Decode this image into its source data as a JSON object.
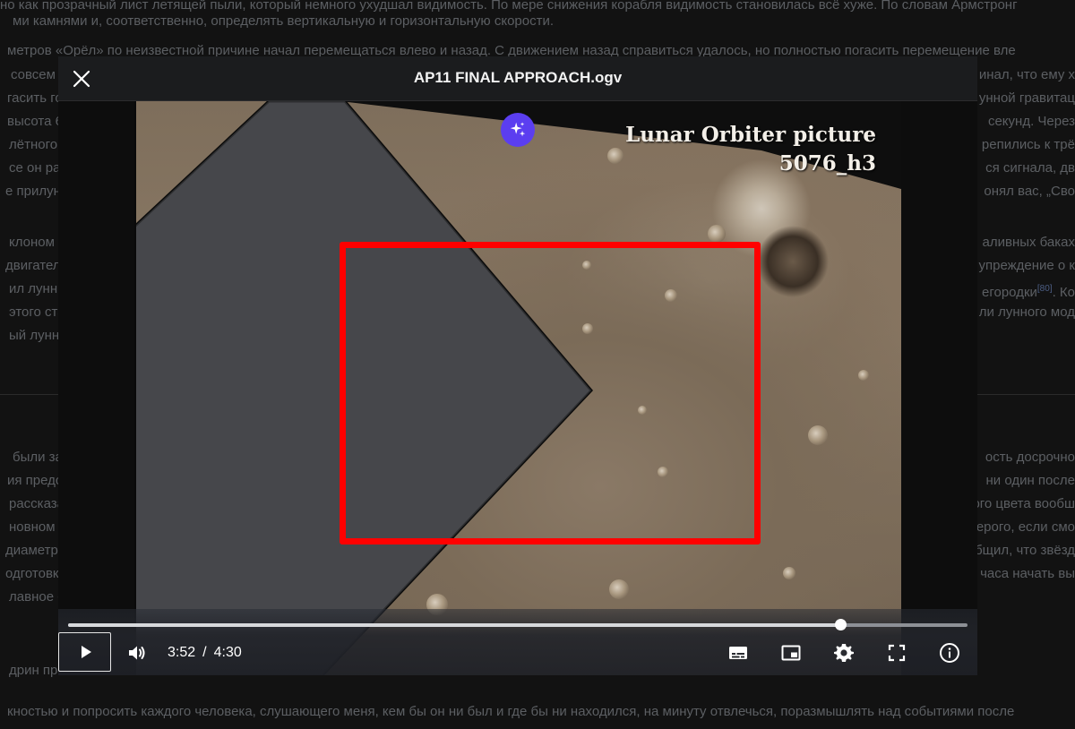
{
  "article": {
    "lines": [
      "но как прозрачный лист летящей пыли, который немного ухудшал видимость. По мере снижения корабля видимость становилась всё хуже. По словам Армстронг",
      "ми камнями и, соответственно, определять вертикальную и горизонтальную скорости.",
      "метров «Орёл» по неизвестной причине начал перемещаться влево и назад. С движением назад справиться удалось, но полностью погасить перемещение вле",
      "совсем м",
      "гасить го",
      "высота 6",
      "лётного в",
      "се он рас",
      "е прилун",
      "клоном и",
      "двигателя",
      "ил лунны",
      "этого ста",
      "ый лунны",
      "были зан",
      "ия предст",
      "рассказа",
      "новном с",
      "диаметро",
      "одготовк",
      "лавное с",
      "дрин про",
      "кностью и попросить каждого человека, слушающего меня, кем бы он ни был и где бы ни находился, на минуту отвлечься, поразмышлять над событиями после"
    ],
    "right_fragments": [
      "инал, что ему х",
      "унной гравитац",
      "секунд. Через",
      "репились к трё",
      "ся сигнала, дв",
      "онял вас, „Сво",
      "аливных баках",
      "упреждение о к",
      "егородки",
      "ли лунного мод",
      "ость досрочно",
      "ни один после",
      "ого цвета вообш",
      "ерого, если смо",
      "бщил, что звёзд",
      "часа начать вы"
    ],
    "footnote": "[80]",
    "footnote_after": ". Ко"
  },
  "dialog": {
    "title": "AP11 FINAL APPROACH.ogv",
    "close_icon": "close-icon"
  },
  "video": {
    "label_line1": "Lunar Orbiter picture",
    "label_line2": "5076_h3",
    "assistant_icon": "sparkle-icon",
    "highlight_color": "#ff0000"
  },
  "player": {
    "current_time": "3:52",
    "separator": "/",
    "duration": "4:30",
    "progress_fraction": 0.859,
    "buttons": {
      "play": "play-icon",
      "volume": "volume-icon",
      "subtitles": "subtitles-icon",
      "pip": "picture-in-picture-icon",
      "settings": "gear-icon",
      "fullscreen": "fullscreen-icon",
      "info": "info-icon"
    }
  }
}
